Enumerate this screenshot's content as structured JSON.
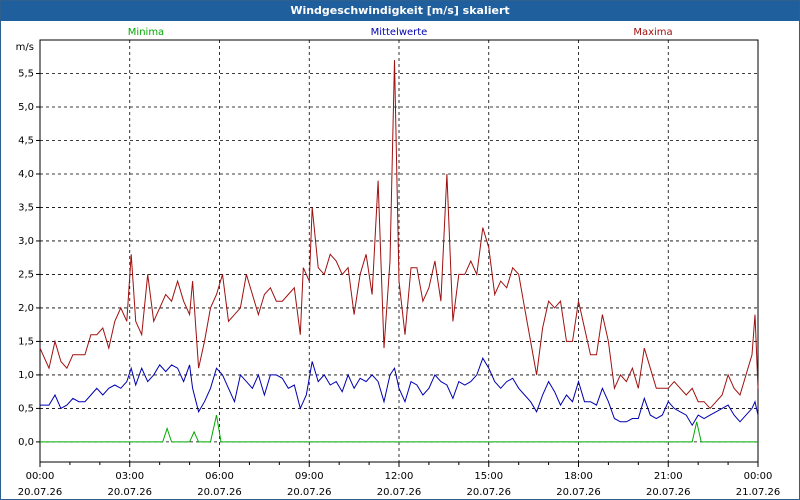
{
  "window": {
    "title": "Windgeschwindigkeit [m/s] skaliert"
  },
  "chart_data": {
    "type": "line",
    "title": "Windgeschwindigkeit [m/s] skaliert",
    "ylabel": "m/s",
    "ylim": [
      -0.3,
      6.0
    ],
    "xlim": [
      "20.07.26 00:00",
      "21.07.26 00:00"
    ],
    "grid": true,
    "legend_position": "top",
    "y_ticks": [
      "0,0",
      "0,5",
      "1,0",
      "1,5",
      "2,0",
      "2,5",
      "3,0",
      "3,5",
      "4,0",
      "4,5",
      "5,0",
      "5,5"
    ],
    "y_tick_values": [
      0,
      0.5,
      1,
      1.5,
      2,
      2.5,
      3,
      3.5,
      4,
      4.5,
      5,
      5.5
    ],
    "x_ticks": [
      {
        "time": "00:00",
        "date": "20.07.26"
      },
      {
        "time": "03:00",
        "date": "20.07.26"
      },
      {
        "time": "06:00",
        "date": "20.07.26"
      },
      {
        "time": "09:00",
        "date": "20.07.26"
      },
      {
        "time": "12:00",
        "date": "20.07.26"
      },
      {
        "time": "15:00",
        "date": "20.07.26"
      },
      {
        "time": "18:00",
        "date": "20.07.26"
      },
      {
        "time": "21:00",
        "date": "20.07.26"
      },
      {
        "time": "00:00",
        "date": "21.07.26"
      }
    ],
    "x_tick_hours": [
      0,
      3,
      6,
      9,
      12,
      15,
      18,
      21,
      24
    ],
    "series": [
      {
        "name": "Maxima",
        "color": "#a01010",
        "points": [
          [
            0,
            1.4
          ],
          [
            0.3,
            1.1
          ],
          [
            0.5,
            1.5
          ],
          [
            0.7,
            1.2
          ],
          [
            0.9,
            1.1
          ],
          [
            1.1,
            1.3
          ],
          [
            1.5,
            1.3
          ],
          [
            1.7,
            1.6
          ],
          [
            1.9,
            1.6
          ],
          [
            2.1,
            1.7
          ],
          [
            2.3,
            1.4
          ],
          [
            2.5,
            1.8
          ],
          [
            2.7,
            2.0
          ],
          [
            2.9,
            1.8
          ],
          [
            3.05,
            2.8
          ],
          [
            3.2,
            1.8
          ],
          [
            3.4,
            1.6
          ],
          [
            3.6,
            2.5
          ],
          [
            3.8,
            1.8
          ],
          [
            4.0,
            2.0
          ],
          [
            4.2,
            2.2
          ],
          [
            4.4,
            2.1
          ],
          [
            4.6,
            2.4
          ],
          [
            4.8,
            2.1
          ],
          [
            5.0,
            1.9
          ],
          [
            5.1,
            2.4
          ],
          [
            5.3,
            1.1
          ],
          [
            5.5,
            1.5
          ],
          [
            5.7,
            2.0
          ],
          [
            5.9,
            2.2
          ],
          [
            6.1,
            2.5
          ],
          [
            6.3,
            1.8
          ],
          [
            6.5,
            1.9
          ],
          [
            6.7,
            2.0
          ],
          [
            6.9,
            2.5
          ],
          [
            7.1,
            2.2
          ],
          [
            7.3,
            1.9
          ],
          [
            7.5,
            2.2
          ],
          [
            7.7,
            2.3
          ],
          [
            7.9,
            2.1
          ],
          [
            8.1,
            2.1
          ],
          [
            8.3,
            2.2
          ],
          [
            8.5,
            2.3
          ],
          [
            8.7,
            1.6
          ],
          [
            8.8,
            2.6
          ],
          [
            9.0,
            2.4
          ],
          [
            9.1,
            3.5
          ],
          [
            9.3,
            2.6
          ],
          [
            9.5,
            2.5
          ],
          [
            9.7,
            2.8
          ],
          [
            9.9,
            2.7
          ],
          [
            10.1,
            2.5
          ],
          [
            10.3,
            2.6
          ],
          [
            10.5,
            1.9
          ],
          [
            10.7,
            2.5
          ],
          [
            10.9,
            2.8
          ],
          [
            11.1,
            2.2
          ],
          [
            11.3,
            3.9
          ],
          [
            11.5,
            1.4
          ],
          [
            11.7,
            2.7
          ],
          [
            11.85,
            5.7
          ],
          [
            12.0,
            2.4
          ],
          [
            12.2,
            1.6
          ],
          [
            12.4,
            2.6
          ],
          [
            12.6,
            2.6
          ],
          [
            12.8,
            2.1
          ],
          [
            13.0,
            2.3
          ],
          [
            13.2,
            2.7
          ],
          [
            13.4,
            2.1
          ],
          [
            13.6,
            4.0
          ],
          [
            13.8,
            1.8
          ],
          [
            14.0,
            2.5
          ],
          [
            14.2,
            2.5
          ],
          [
            14.4,
            2.7
          ],
          [
            14.6,
            2.5
          ],
          [
            14.8,
            3.2
          ],
          [
            15.0,
            2.9
          ],
          [
            15.2,
            2.2
          ],
          [
            15.4,
            2.4
          ],
          [
            15.6,
            2.3
          ],
          [
            15.8,
            2.6
          ],
          [
            16.0,
            2.5
          ],
          [
            16.2,
            2.0
          ],
          [
            16.4,
            1.5
          ],
          [
            16.6,
            1.0
          ],
          [
            16.8,
            1.7
          ],
          [
            17.0,
            2.1
          ],
          [
            17.2,
            2.0
          ],
          [
            17.4,
            2.1
          ],
          [
            17.6,
            1.5
          ],
          [
            17.8,
            1.5
          ],
          [
            18.0,
            2.1
          ],
          [
            18.2,
            1.7
          ],
          [
            18.4,
            1.3
          ],
          [
            18.6,
            1.3
          ],
          [
            18.8,
            1.9
          ],
          [
            19.0,
            1.5
          ],
          [
            19.2,
            0.8
          ],
          [
            19.4,
            1.0
          ],
          [
            19.6,
            0.9
          ],
          [
            19.8,
            1.1
          ],
          [
            20.0,
            0.8
          ],
          [
            20.2,
            1.4
          ],
          [
            20.4,
            1.1
          ],
          [
            20.6,
            0.8
          ],
          [
            20.8,
            0.8
          ],
          [
            21.0,
            0.8
          ],
          [
            21.2,
            0.9
          ],
          [
            21.4,
            0.8
          ],
          [
            21.6,
            0.7
          ],
          [
            21.8,
            0.8
          ],
          [
            22.0,
            0.6
          ],
          [
            22.2,
            0.6
          ],
          [
            22.4,
            0.5
          ],
          [
            22.6,
            0.6
          ],
          [
            22.8,
            0.7
          ],
          [
            23.0,
            1.0
          ],
          [
            23.2,
            0.8
          ],
          [
            23.4,
            0.7
          ],
          [
            23.6,
            1.0
          ],
          [
            23.8,
            1.3
          ],
          [
            23.9,
            1.9
          ],
          [
            24.0,
            0.8
          ]
        ]
      },
      {
        "name": "Mittelwerte",
        "color": "#0000b0",
        "points": [
          [
            0,
            0.55
          ],
          [
            0.3,
            0.55
          ],
          [
            0.5,
            0.7
          ],
          [
            0.7,
            0.5
          ],
          [
            0.9,
            0.55
          ],
          [
            1.1,
            0.65
          ],
          [
            1.3,
            0.6
          ],
          [
            1.5,
            0.6
          ],
          [
            1.7,
            0.7
          ],
          [
            1.9,
            0.8
          ],
          [
            2.1,
            0.7
          ],
          [
            2.3,
            0.8
          ],
          [
            2.5,
            0.85
          ],
          [
            2.7,
            0.8
          ],
          [
            2.9,
            0.9
          ],
          [
            3.05,
            1.1
          ],
          [
            3.2,
            0.85
          ],
          [
            3.4,
            1.1
          ],
          [
            3.6,
            0.9
          ],
          [
            3.8,
            1.0
          ],
          [
            4.0,
            1.15
          ],
          [
            4.2,
            1.05
          ],
          [
            4.4,
            1.15
          ],
          [
            4.6,
            1.1
          ],
          [
            4.8,
            0.9
          ],
          [
            5.0,
            1.15
          ],
          [
            5.1,
            0.8
          ],
          [
            5.3,
            0.45
          ],
          [
            5.5,
            0.6
          ],
          [
            5.7,
            0.8
          ],
          [
            5.9,
            1.1
          ],
          [
            6.1,
            1.0
          ],
          [
            6.3,
            0.8
          ],
          [
            6.5,
            0.6
          ],
          [
            6.7,
            1.0
          ],
          [
            6.9,
            0.9
          ],
          [
            7.1,
            0.8
          ],
          [
            7.3,
            1.0
          ],
          [
            7.5,
            0.7
          ],
          [
            7.7,
            1.0
          ],
          [
            7.9,
            1.0
          ],
          [
            8.1,
            0.95
          ],
          [
            8.3,
            0.8
          ],
          [
            8.5,
            0.85
          ],
          [
            8.7,
            0.5
          ],
          [
            8.9,
            0.7
          ],
          [
            9.1,
            1.2
          ],
          [
            9.3,
            0.9
          ],
          [
            9.5,
            1.0
          ],
          [
            9.7,
            0.85
          ],
          [
            9.9,
            0.9
          ],
          [
            10.1,
            0.75
          ],
          [
            10.3,
            1.0
          ],
          [
            10.5,
            0.8
          ],
          [
            10.7,
            0.95
          ],
          [
            10.9,
            0.9
          ],
          [
            11.1,
            1.0
          ],
          [
            11.3,
            0.9
          ],
          [
            11.5,
            0.6
          ],
          [
            11.7,
            1.0
          ],
          [
            11.85,
            1.1
          ],
          [
            12.0,
            0.8
          ],
          [
            12.2,
            0.6
          ],
          [
            12.4,
            0.9
          ],
          [
            12.6,
            0.85
          ],
          [
            12.8,
            0.7
          ],
          [
            13.0,
            0.8
          ],
          [
            13.2,
            1.0
          ],
          [
            13.4,
            0.9
          ],
          [
            13.6,
            0.85
          ],
          [
            13.8,
            0.65
          ],
          [
            14.0,
            0.9
          ],
          [
            14.2,
            0.85
          ],
          [
            14.4,
            0.9
          ],
          [
            14.6,
            1.0
          ],
          [
            14.8,
            1.25
          ],
          [
            15.0,
            1.1
          ],
          [
            15.2,
            0.9
          ],
          [
            15.4,
            0.8
          ],
          [
            15.6,
            0.9
          ],
          [
            15.8,
            0.95
          ],
          [
            16.0,
            0.8
          ],
          [
            16.2,
            0.7
          ],
          [
            16.4,
            0.6
          ],
          [
            16.6,
            0.45
          ],
          [
            16.8,
            0.7
          ],
          [
            17.0,
            0.9
          ],
          [
            17.2,
            0.75
          ],
          [
            17.4,
            0.55
          ],
          [
            17.6,
            0.7
          ],
          [
            17.8,
            0.6
          ],
          [
            18.0,
            0.9
          ],
          [
            18.2,
            0.6
          ],
          [
            18.4,
            0.6
          ],
          [
            18.6,
            0.55
          ],
          [
            18.8,
            0.8
          ],
          [
            19.0,
            0.6
          ],
          [
            19.2,
            0.35
          ],
          [
            19.4,
            0.3
          ],
          [
            19.6,
            0.3
          ],
          [
            19.8,
            0.35
          ],
          [
            20.0,
            0.35
          ],
          [
            20.2,
            0.65
          ],
          [
            20.4,
            0.4
          ],
          [
            20.6,
            0.35
          ],
          [
            20.8,
            0.4
          ],
          [
            21.0,
            0.6
          ],
          [
            21.2,
            0.5
          ],
          [
            21.4,
            0.45
          ],
          [
            21.6,
            0.4
          ],
          [
            21.8,
            0.25
          ],
          [
            22.0,
            0.4
          ],
          [
            22.2,
            0.35
          ],
          [
            22.4,
            0.4
          ],
          [
            22.6,
            0.45
          ],
          [
            22.8,
            0.5
          ],
          [
            23.0,
            0.55
          ],
          [
            23.2,
            0.4
          ],
          [
            23.4,
            0.3
          ],
          [
            23.6,
            0.4
          ],
          [
            23.8,
            0.5
          ],
          [
            23.9,
            0.6
          ],
          [
            24.0,
            0.4
          ]
        ]
      },
      {
        "name": "Minima",
        "color": "#00aa00",
        "points": [
          [
            0,
            0
          ],
          [
            4.1,
            0
          ],
          [
            4.25,
            0.2
          ],
          [
            4.4,
            0
          ],
          [
            5.0,
            0
          ],
          [
            5.15,
            0.15
          ],
          [
            5.3,
            0
          ],
          [
            5.7,
            0
          ],
          [
            5.9,
            0.4
          ],
          [
            6.05,
            0
          ],
          [
            21.8,
            0
          ],
          [
            21.95,
            0.3
          ],
          [
            22.1,
            0
          ],
          [
            24.0,
            0
          ]
        ]
      }
    ]
  }
}
